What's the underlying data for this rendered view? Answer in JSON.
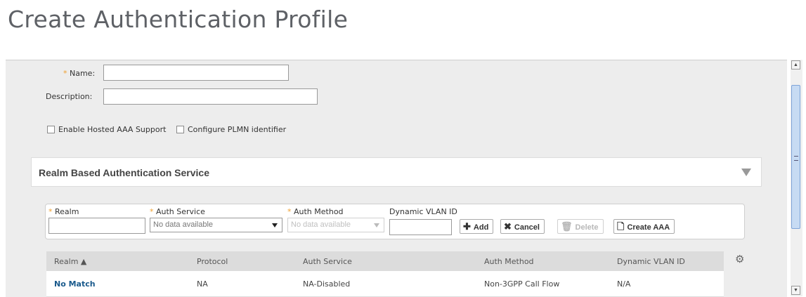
{
  "page_title": "Create Authentication Profile",
  "form": {
    "name_label": "Name:",
    "name_value": "",
    "description_label": "Description:",
    "description_value": "",
    "checkbox_hosted_aaa": "Enable Hosted AAA Support",
    "checkbox_plmn": "Configure PLMN identifier"
  },
  "section": {
    "title": "Realm Based Authentication Service"
  },
  "realm_form": {
    "realm_label": "Realm",
    "auth_service_label": "Auth Service",
    "auth_service_placeholder": "No data available",
    "auth_method_label": "Auth Method",
    "auth_method_placeholder": "No data available",
    "dynamic_vlan_label": "Dynamic VLAN ID",
    "buttons": {
      "add": "Add",
      "cancel": "Cancel",
      "delete": "Delete",
      "create_aaa": "Create AAA"
    }
  },
  "table": {
    "columns": [
      "Realm ▲",
      "Protocol",
      "Auth Service",
      "Auth Method",
      "Dynamic VLAN ID"
    ],
    "rows": [
      [
        "No Match",
        "NA",
        "NA-Disabled",
        "Non-3GPP Call Flow",
        "N/A"
      ]
    ]
  },
  "colors": {
    "required_marker": "#f0a030",
    "link": "#1a5a8c",
    "scroll_thumb": "#c7dbf3"
  },
  "icons": [
    "plus-icon",
    "x-icon",
    "trash-icon",
    "document-icon",
    "gear-icon",
    "chevron-down-icon"
  ]
}
